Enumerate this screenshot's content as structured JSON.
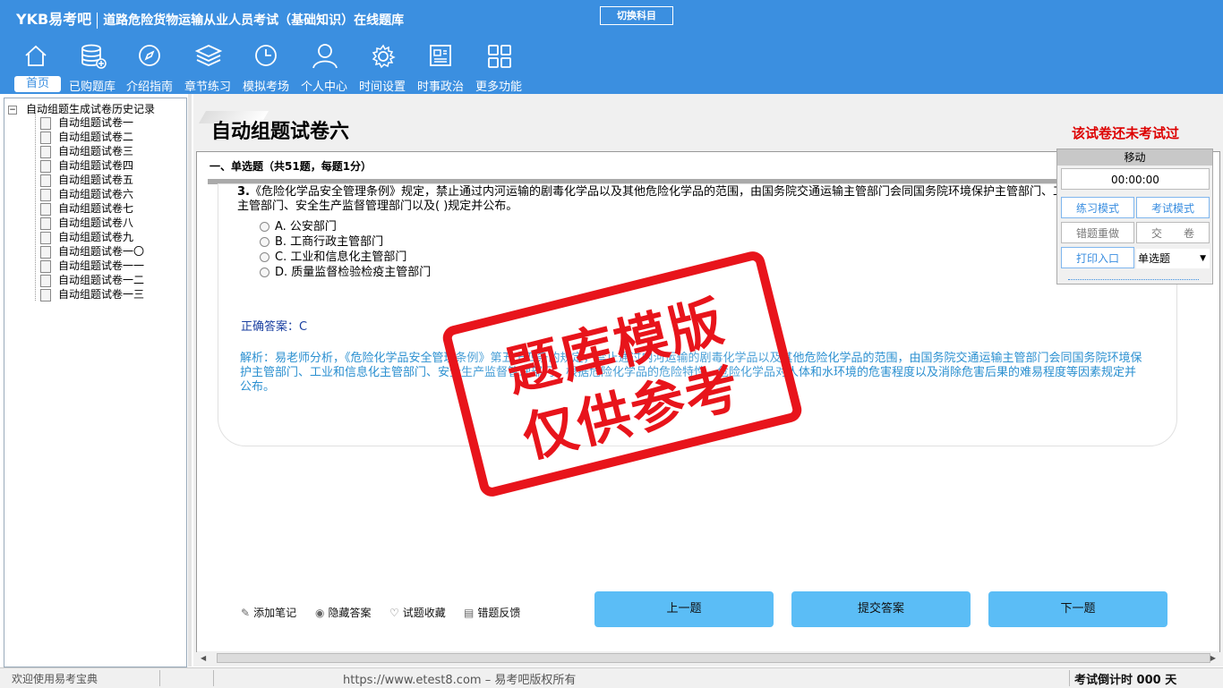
{
  "header": {
    "logo": "YKB易考吧",
    "title": "道路危险货物运输从业人员考试（基础知识）在线题库",
    "switch_button": "切换科目"
  },
  "nav": [
    {
      "label": "首页",
      "icon": "home-icon"
    },
    {
      "label": "已购题库",
      "icon": "database-icon"
    },
    {
      "label": "介绍指南",
      "icon": "compass-icon"
    },
    {
      "label": "章节练习",
      "icon": "layers-icon"
    },
    {
      "label": "模拟考场",
      "icon": "clock-icon"
    },
    {
      "label": "个人中心",
      "icon": "user-icon"
    },
    {
      "label": "时间设置",
      "icon": "gear-icon"
    },
    {
      "label": "时事政治",
      "icon": "news-icon"
    },
    {
      "label": "更多功能",
      "icon": "grid-icon"
    }
  ],
  "tree": {
    "root": "自动组题生成试卷历史记录",
    "items": [
      "自动组题试卷一",
      "自动组题试卷二",
      "自动组题试卷三",
      "自动组题试卷四",
      "自动组题试卷五",
      "自动组题试卷六",
      "自动组题试卷七",
      "自动组题试卷八",
      "自动组题试卷九",
      "自动组题试卷一〇",
      "自动组题试卷一一",
      "自动组题试卷一二",
      "自动组题试卷一三"
    ]
  },
  "paper": {
    "title": "自动组题试卷六",
    "status": "该试卷还未考试过",
    "section": "一、单选题（共51题，每题1分）"
  },
  "question": {
    "number": "3.",
    "text": "《危险化学品安全管理条例》规定，禁止通过内河运输的剧毒化学品以及其他危险化学品的范围，由国务院交通运输主管部门会同国务院环境保护主管部门、工业和信息化主管部门、安全生产监督管理部门以及(  )规定并公布。",
    "options": [
      "A. 公安部门",
      "B. 工商行政主管部门",
      "C. 工业和信息化主管部门",
      "D. 质量监督检验检疫主管部门"
    ],
    "answer": "正确答案：C",
    "analysis": "解析：易老师分析，《危险化学品安全管理条例》第五十四条的规定，禁止通过内河运输的剧毒化学品以及其他危险化学品的范围，由国务院交通运输主管部门会同国务院环境保护主管部门、工业和信息化主管部门、安全生产监督管理部门，根据危险化学品的危险特性、危险化学品对人体和水环境的危害程度以及消除危害后果的难易程度等因素规定并公布。"
  },
  "panel": {
    "move": "移动",
    "timer": "00:00:00",
    "practice_mode": "练习模式",
    "exam_mode": "考试模式",
    "redo_wrong": "错题重做",
    "submit_paper": "交　　卷",
    "print": "打印入口",
    "type_select": "单选题"
  },
  "stamp": {
    "line1": "题库模版",
    "line2": "仅供参考"
  },
  "tools": {
    "note": "添加笔记",
    "hide_answer": "隐藏答案",
    "favorite": "试题收藏",
    "report": "错题反馈"
  },
  "buttons": {
    "prev": "上一题",
    "submit": "提交答案",
    "next": "下一题"
  },
  "statusbar": {
    "welcome": "欢迎使用易考宝典",
    "url": "https://www.etest8.com – 易考吧版权所有",
    "countdown": "考试倒计时 000 天"
  }
}
